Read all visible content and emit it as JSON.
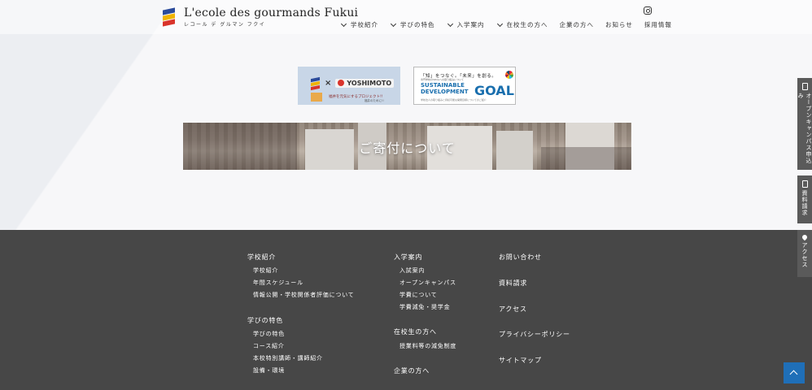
{
  "header": {
    "logo_title": "L'ecole des gourmands Fukui",
    "logo_sub": "レコール デ グルマン フクイ",
    "nav": [
      {
        "label": "学校紹介",
        "has_dropdown": true
      },
      {
        "label": "学びの特色",
        "has_dropdown": true
      },
      {
        "label": "入学案内",
        "has_dropdown": true
      },
      {
        "label": "在校生の方へ",
        "has_dropdown": true
      },
      {
        "label": "企業の方へ",
        "has_dropdown": false
      },
      {
        "label": "お知らせ",
        "has_dropdown": false
      },
      {
        "label": "採用情報",
        "has_dropdown": false
      }
    ],
    "instagram_icon": "instagram-icon"
  },
  "banners": {
    "yoshimoto": {
      "brand": "YOSHIMOTO",
      "times": "×",
      "caption": "福井を元気にするプロジェクト!!",
      "caption2": "福井のために!!"
    },
    "sdgs": {
      "tagline": "「知」をつなぐ。「未来」を創る。",
      "small": "専門学校のSDGsへの取り組みについて",
      "name_line1": "SUSTAINABLE",
      "name_line2": "DEVELOPMENT",
      "goals": "GOALS",
      "foot": "学校法人の取り組みと持続可能な開発目標についてのご紹介"
    }
  },
  "donation": {
    "title": "ご寄付について"
  },
  "footer": {
    "col1": {
      "heading1": "学校紹介",
      "links1": [
        "学校紹介",
        "年間スケジュール",
        "情報公開・学校関係者評価について"
      ],
      "heading2": "学びの特色",
      "links2": [
        "学びの特色",
        "コース紹介",
        "本校特別講師・講師紹介",
        "設備・環境"
      ]
    },
    "col2": {
      "heading1": "入学案内",
      "links1": [
        "入試案内",
        "オープンキャンパス",
        "学費について",
        "学費減免・奨学金"
      ],
      "heading2": "在校生の方へ",
      "links2": [
        "授業料等の減免制度"
      ],
      "heading3": "企業の方へ"
    },
    "col3": [
      "お問い合わせ",
      "資料請求",
      "アクセス",
      "プライバシーポリシー",
      "サイトマップ"
    ]
  },
  "side_tabs": [
    {
      "label": "オープンキャンパス申込み",
      "icon": "document-icon"
    },
    {
      "label": "資料請求",
      "icon": "document-icon"
    },
    {
      "label": "アクセス",
      "icon": "map-pin-icon"
    }
  ],
  "colors": {
    "footer_bg": "#474747",
    "side_tab_bg": "#5a5a5a",
    "page_top_button": "#1f6fb8"
  }
}
